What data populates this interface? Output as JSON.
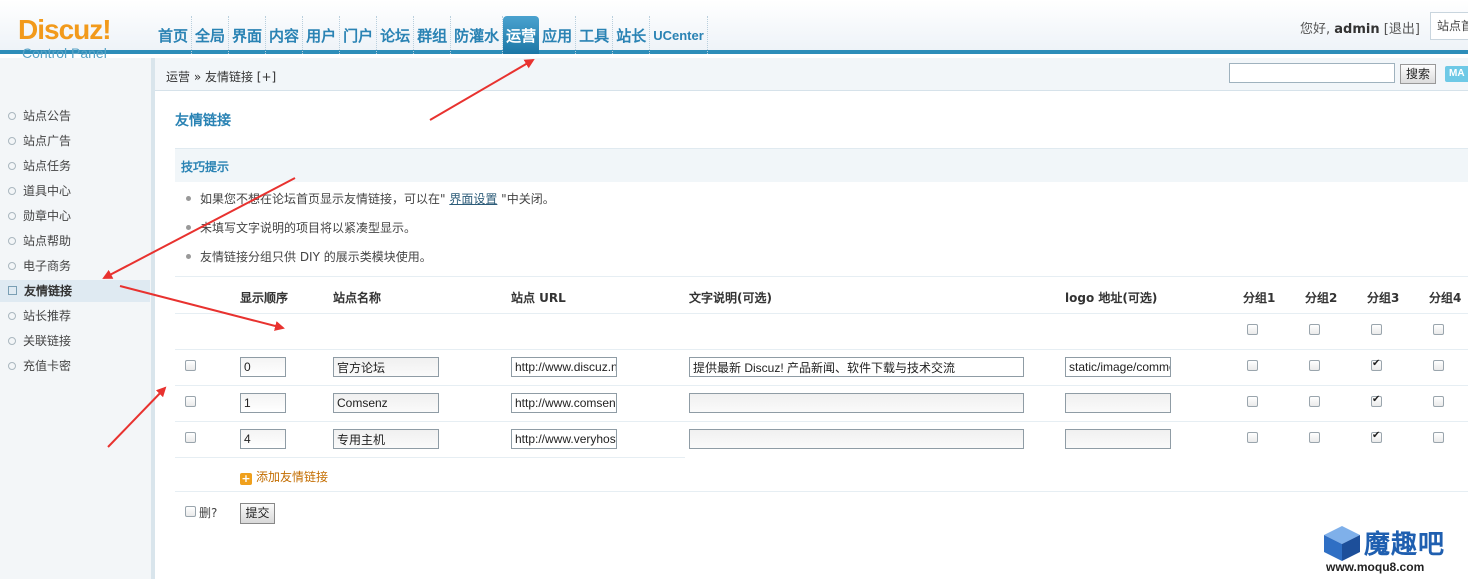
{
  "header": {
    "logo": {
      "brand": "Discuz!",
      "subtitle": "Control Panel"
    },
    "nav": [
      "首页",
      "全局",
      "界面",
      "内容",
      "用户",
      "门户",
      "论坛",
      "群组",
      "防灌水",
      "运营",
      "应用",
      "工具",
      "站长",
      "UCenter"
    ],
    "active_nav": "运营",
    "greeting": "您好,",
    "username": "admin",
    "logout": "[退出]",
    "site_home": "站点首页"
  },
  "subbar": {
    "breadcrumb": "运营 » 友情链接 [+]",
    "search_value": "",
    "search_button": "搜索",
    "map_button": "MA"
  },
  "sidebar": {
    "items": [
      "站点公告",
      "站点广告",
      "站点任务",
      "道具中心",
      "勋章中心",
      "站点帮助",
      "电子商务",
      "友情链接",
      "站长推荐",
      "关联链接",
      "充值卡密"
    ],
    "active_item": "友情链接"
  },
  "main": {
    "title": "友情链接",
    "tips_title": "技巧提示",
    "tips": [
      {
        "before": "如果您不想在论坛首页显示友情链接，可以在\" ",
        "link": "界面设置",
        "after": " \"中关闭。"
      },
      {
        "before": "未填写文字说明的项目将以紧凑型显示。",
        "link": "",
        "after": ""
      },
      {
        "before": "友情链接分组只供 DIY 的展示类模块使用。",
        "link": "",
        "after": ""
      }
    ],
    "columns": [
      "显示顺序",
      "站点名称",
      "站点 URL",
      "文字说明(可选)",
      "logo 地址(可选)",
      "分组1",
      "分组2",
      "分组3",
      "分组4"
    ],
    "group_header_checks": [
      false,
      false,
      false,
      false
    ],
    "rows": [
      {
        "delete": false,
        "order": "0",
        "name": "官方论坛",
        "url": "http://www.discuz.net",
        "description": "提供最新 Discuz! 产品新闻、软件下载与技术交流",
        "logo": "static/image/common/logo.gif",
        "groups": [
          false,
          false,
          true,
          false
        ]
      },
      {
        "delete": false,
        "order": "1",
        "name": "Comsenz",
        "url": "http://www.comsenz.com",
        "description": "",
        "logo": "",
        "groups": [
          false,
          false,
          true,
          false
        ]
      },
      {
        "delete": false,
        "order": "4",
        "name": "专用主机",
        "url": "http://www.veryhost.com",
        "description": "",
        "logo": "",
        "groups": [
          false,
          false,
          true,
          false
        ]
      }
    ],
    "add_link": "添加友情链接",
    "delete_label": "删?",
    "submit": "提交"
  },
  "watermark": {
    "name": "魔趣吧",
    "url": "www.moqu8.com"
  },
  "colors": {
    "accent": "#2a83b4",
    "annotation_arrow": "#e8322f",
    "logo": "#f29a1b"
  }
}
